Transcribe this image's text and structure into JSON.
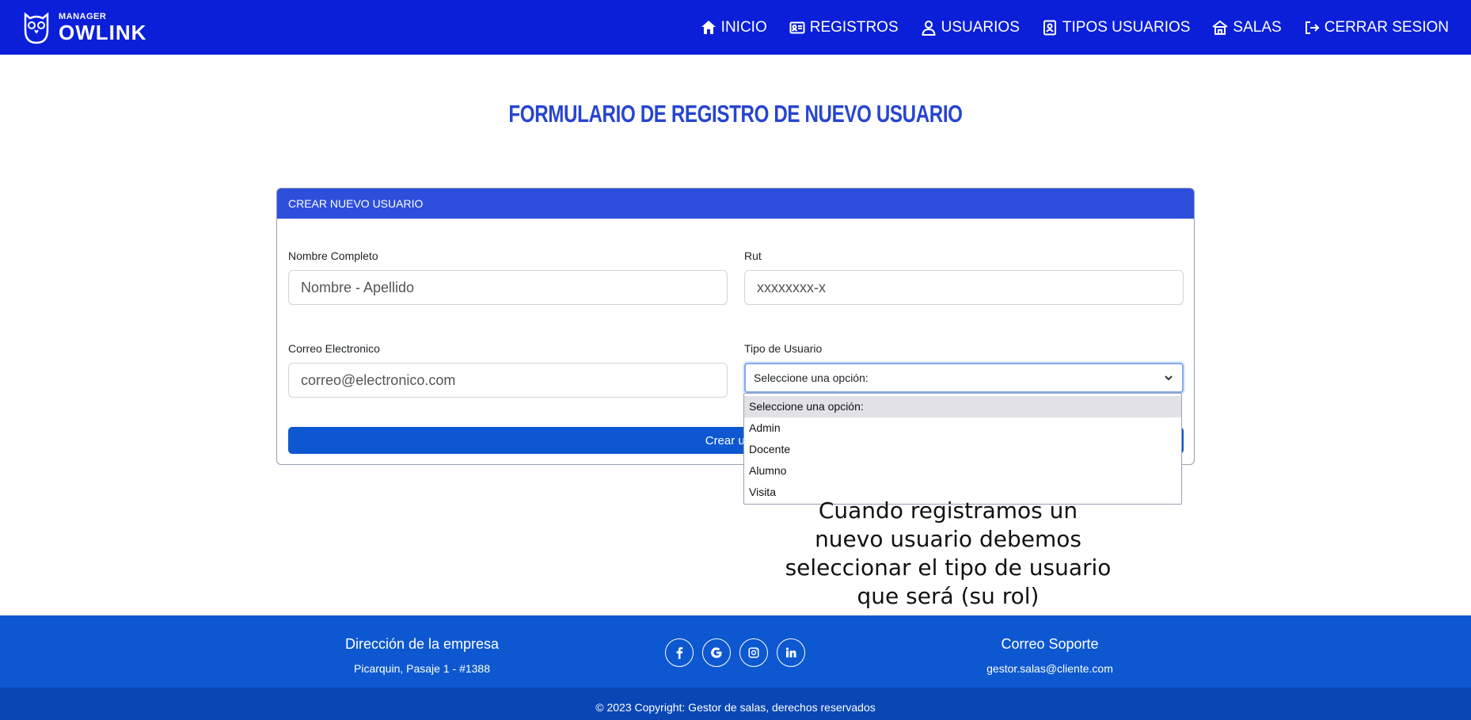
{
  "brand": {
    "small": "MANAGER",
    "big": "OWLINK"
  },
  "nav": [
    {
      "label": "INICIO",
      "icon": "home-icon"
    },
    {
      "label": "REGISTROS",
      "icon": "id-card-icon"
    },
    {
      "label": "USUARIOS",
      "icon": "user-icon"
    },
    {
      "label": "TIPOS USUARIOS",
      "icon": "contact-book-icon"
    },
    {
      "label": "SALAS",
      "icon": "building-icon"
    },
    {
      "label": "CERRAR SESION",
      "icon": "logout-icon"
    }
  ],
  "page_title": "FORMULARIO DE REGISTRO DE NUEVO USUARIO",
  "card": {
    "header": "CREAR NUEVO USUARIO",
    "name_label": "Nombre Completo",
    "name_placeholder": "Nombre - Apellido",
    "rut_label": "Rut",
    "rut_placeholder": "xxxxxxxx-x",
    "email_label": "Correo Electronico",
    "email_placeholder": "correo@electronico.com",
    "type_label": "Tipo de Usuario",
    "type_selected": "Seleccione una opción:",
    "submit_label": "Crear us"
  },
  "dropdown": {
    "options": [
      "Seleccione una opción:",
      "Admin",
      "Docente",
      "Alumno",
      "Visita"
    ]
  },
  "annotation": "Cuando registramos un nuevo usuario debemos seleccionar el tipo de usuario que será (su rol)",
  "footer": {
    "address_title": "Dirección de la empresa",
    "address": "Picarquin, Pasaje 1 - #1388",
    "support_title": "Correo Soporte",
    "support_email": "gestor.salas@cliente.com",
    "socials": [
      "facebook-icon",
      "google-icon",
      "instagram-icon",
      "linkedin-icon"
    ],
    "copyright": "© 2023 Copyright: Gestor de salas, derechos reservados"
  },
  "colors": {
    "nav_bg": "#0b1fd9",
    "title": "#2745d0",
    "card_header": "#2d4fdc",
    "button": "#0d58d0",
    "footer": "#0d58d0",
    "copyright_bg": "#0a47b4"
  }
}
